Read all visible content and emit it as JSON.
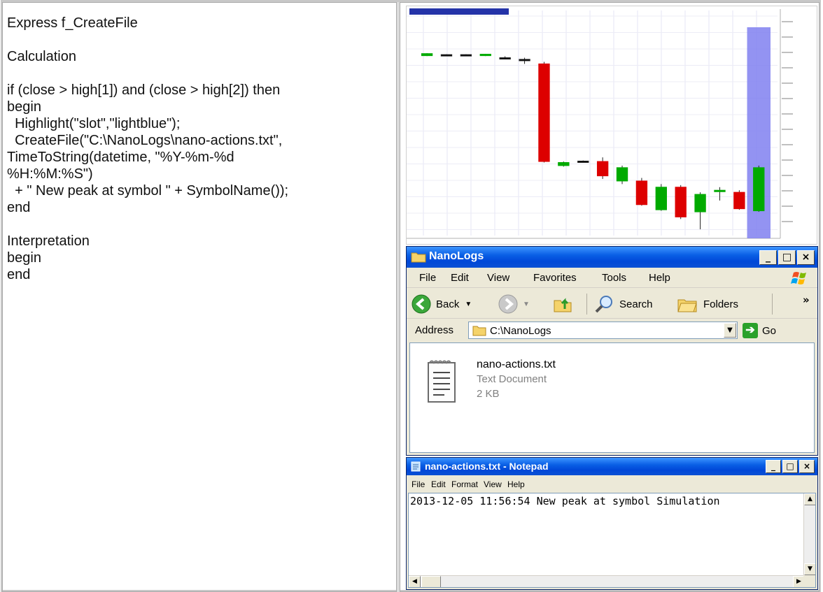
{
  "code": {
    "lines": [
      "Express f_CreateFile",
      "",
      "Calculation",
      "",
      "if (close > high[1]) and (close > high[2]) then",
      "begin",
      "  Highlight(\"slot\",\"lightblue\");",
      "  CreateFile(\"C:\\NanoLogs\\nano-actions.txt\",",
      "TimeToString(datetime, \"%Y-%m-%d",
      "%H:%M:%S\")",
      "  + \" New peak at symbol \" + SymbolName());",
      "end",
      "",
      "Interpretation",
      "begin",
      "end"
    ]
  },
  "chart_data": {
    "type": "candlestick",
    "colors": {
      "up": "#00aa00",
      "down": "#dd0000",
      "doji": "#000000",
      "highlight": "#8080f0"
    },
    "candles": [
      {
        "open": 0.855,
        "close": 0.865,
        "high": 0.867,
        "low": 0.853
      },
      {
        "open": 0.86,
        "close": 0.855,
        "high": 0.862,
        "low": 0.852
      },
      {
        "open": 0.855,
        "close": 0.86,
        "high": 0.862,
        "low": 0.853
      },
      {
        "open": 0.855,
        "close": 0.862,
        "high": 0.864,
        "low": 0.853
      },
      {
        "open": 0.845,
        "close": 0.843,
        "high": 0.852,
        "low": 0.838
      },
      {
        "open": 0.837,
        "close": 0.836,
        "high": 0.845,
        "low": 0.815
      },
      {
        "open": 0.815,
        "close": 0.34,
        "high": 0.825,
        "low": 0.335
      },
      {
        "open": 0.32,
        "close": 0.335,
        "high": 0.34,
        "low": 0.315
      },
      {
        "open": 0.34,
        "close": 0.342,
        "high": 0.345,
        "low": 0.338
      },
      {
        "open": 0.34,
        "close": 0.27,
        "high": 0.36,
        "low": 0.255
      },
      {
        "open": 0.245,
        "close": 0.31,
        "high": 0.32,
        "low": 0.23
      },
      {
        "open": 0.245,
        "close": 0.13,
        "high": 0.26,
        "low": 0.125
      },
      {
        "open": 0.105,
        "close": 0.215,
        "high": 0.23,
        "low": 0.1
      },
      {
        "open": 0.215,
        "close": 0.07,
        "high": 0.225,
        "low": 0.06
      },
      {
        "open": 0.095,
        "close": 0.18,
        "high": 0.19,
        "low": 0.01
      },
      {
        "open": 0.193,
        "close": 0.2,
        "high": 0.215,
        "low": 0.15
      },
      {
        "open": 0.19,
        "close": 0.11,
        "high": 0.2,
        "low": 0.105
      },
      {
        "open": 0.1,
        "close": 0.31,
        "high": 0.32,
        "low": 0.095
      }
    ],
    "highlight_index": 17
  },
  "explorer": {
    "title": "NanoLogs",
    "menu": [
      "File",
      "Edit",
      "View",
      "Favorites",
      "Tools",
      "Help"
    ],
    "toolbar": {
      "back": "Back",
      "search": "Search",
      "folders": "Folders",
      "more": "»"
    },
    "address_label": "Address",
    "address_value": "C:\\NanoLogs",
    "go_label": "Go",
    "file": {
      "name": "nano-actions.txt",
      "type": "Text Document",
      "size": "2 KB"
    }
  },
  "notepad": {
    "title": "nano-actions.txt - Notepad",
    "menu": [
      "File",
      "Edit",
      "Format",
      "View",
      "Help"
    ],
    "text": "2013-12-05 11:56:54 New peak at symbol Simulation"
  },
  "caption_buttons": {
    "min": "_",
    "max": "□",
    "close": "×"
  }
}
